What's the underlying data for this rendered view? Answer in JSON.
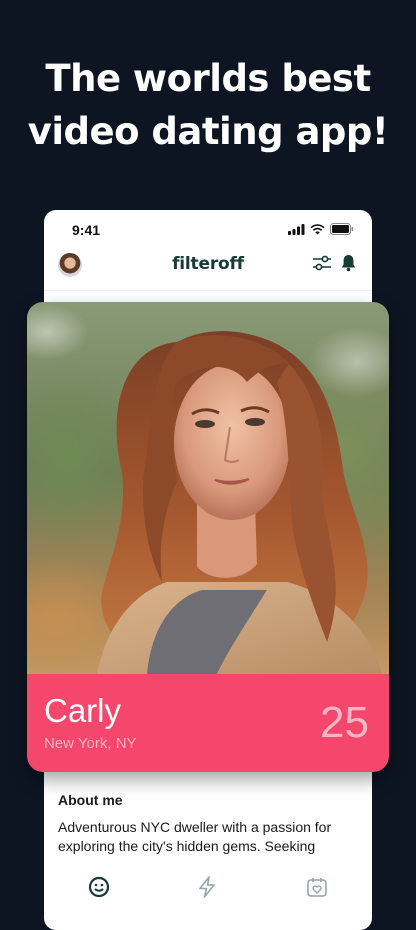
{
  "promo": {
    "line1": "The worlds best",
    "line2": "video dating app!"
  },
  "status_bar": {
    "time": "9:41"
  },
  "header": {
    "logo_text": "filteroff"
  },
  "profile": {
    "name": "Carly",
    "location": "New York, NY",
    "age": "25"
  },
  "about": {
    "title": "About me",
    "text": "Adventurous NYC dweller with a passion for exploring the city's hidden gems. Seeking"
  },
  "tabs": [
    {
      "icon": "smile-icon"
    },
    {
      "icon": "lightning-icon"
    },
    {
      "icon": "calendar-heart-icon"
    }
  ],
  "colors": {
    "background": "#0c1521",
    "accent_pink": "#f5466b",
    "logo_green": "#173a33"
  }
}
